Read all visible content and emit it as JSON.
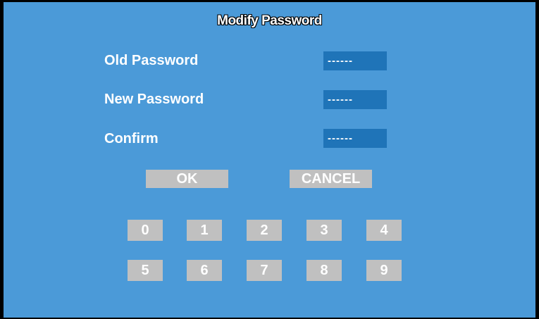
{
  "dialog": {
    "title": "Modify Password"
  },
  "fields": {
    "old_password": {
      "label": "Old Password",
      "value": "------"
    },
    "new_password": {
      "label": "New Password",
      "value": "------"
    },
    "confirm": {
      "label": "Confirm",
      "value": "------"
    }
  },
  "buttons": {
    "ok": "OK",
    "cancel": "CANCEL"
  },
  "keypad": {
    "keys": [
      "0",
      "1",
      "2",
      "3",
      "4",
      "5",
      "6",
      "7",
      "8",
      "9"
    ]
  },
  "colors": {
    "background": "#4b9ad8",
    "field": "#1f74b8",
    "button": "#c0c0c0",
    "text": "#ffffff"
  }
}
